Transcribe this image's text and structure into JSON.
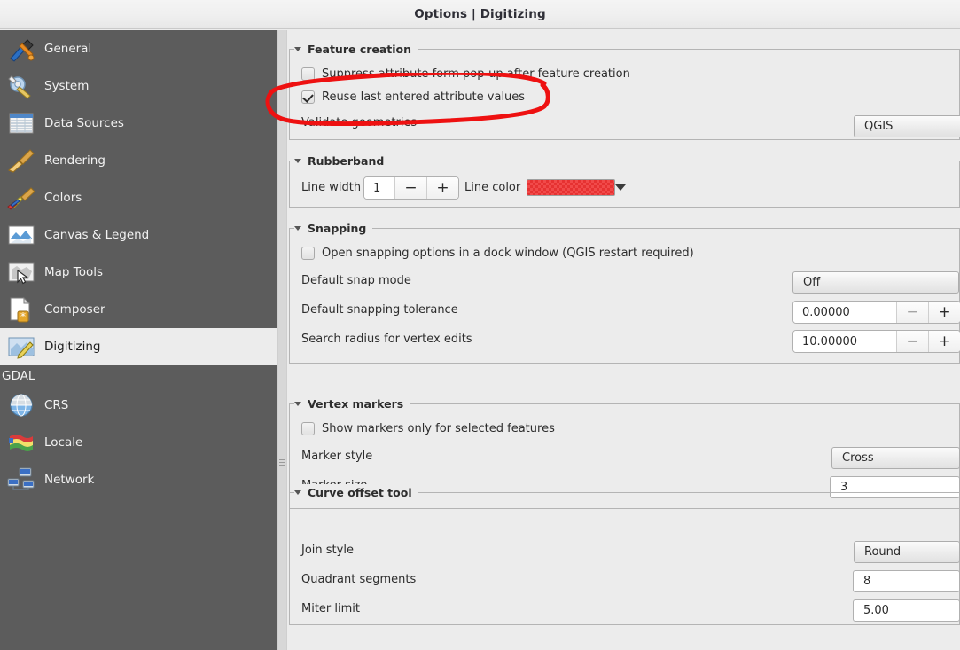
{
  "window": {
    "title": "Options | Digitizing"
  },
  "sidebar": {
    "items": [
      {
        "label": "General",
        "icon": "hammer-wrench-icon",
        "selected": false
      },
      {
        "label": "System",
        "icon": "gear-wrench-icon",
        "selected": false
      },
      {
        "label": "Data Sources",
        "icon": "table-icon",
        "selected": false
      },
      {
        "label": "Rendering",
        "icon": "broom-icon",
        "selected": false
      },
      {
        "label": "Colors",
        "icon": "color-broom-icon",
        "selected": false
      },
      {
        "label": "Canvas & Legend",
        "icon": "map-canvas-icon",
        "selected": false
      },
      {
        "label": "Map Tools",
        "icon": "map-cursor-icon",
        "selected": false
      },
      {
        "label": "Composer",
        "icon": "page-star-icon",
        "selected": false
      },
      {
        "label": "Digitizing",
        "icon": "map-pencil-icon",
        "selected": true
      }
    ],
    "group_label": "GDAL",
    "group_items": [
      {
        "label": "CRS",
        "icon": "globe-icon",
        "selected": false
      },
      {
        "label": "Locale",
        "icon": "flag-icon",
        "selected": false
      },
      {
        "label": "Network",
        "icon": "network-icon",
        "selected": false
      }
    ]
  },
  "sections": {
    "feature_creation": {
      "title": "Feature creation",
      "suppress_label": "Suppress attribute form pop-up after feature creation",
      "suppress_checked": false,
      "reuse_label": "Reuse last entered attribute values",
      "reuse_checked": true,
      "validate_label": "Validate geometries",
      "validate_value": "QGIS"
    },
    "rubberband": {
      "title": "Rubberband",
      "line_width_label": "Line width",
      "line_width_value": "1",
      "minus_label": "−",
      "plus_label": "+",
      "line_color_label": "Line color",
      "line_color_value": "#f03d3d"
    },
    "snapping": {
      "title": "Snapping",
      "dock_label": "Open snapping options in a dock window (QGIS restart required)",
      "dock_checked": false,
      "snap_mode_label": "Default snap mode",
      "snap_mode_value": "Off",
      "tolerance_label": "Default snapping tolerance",
      "tolerance_value": "0.00000",
      "radius_label": "Search radius for vertex edits",
      "radius_value": "10.00000"
    },
    "vertex_markers": {
      "title": "Vertex markers",
      "show_only_label": "Show markers only for selected features",
      "show_only_checked": false,
      "marker_style_label": "Marker style",
      "marker_style_value": "Cross",
      "marker_size_label": "Marker size",
      "marker_size_value": "3"
    },
    "curve_offset": {
      "title": "Curve offset tool",
      "join_style_label": "Join style",
      "join_style_value": "Round",
      "quadrant_label": "Quadrant segments",
      "quadrant_value": "8",
      "miter_label": "Miter limit",
      "miter_value": "5.00"
    }
  },
  "annotation": {
    "shape": "red-ellipse-highlight",
    "color": "#ee1111",
    "targets": "Reuse last entered attribute values"
  }
}
